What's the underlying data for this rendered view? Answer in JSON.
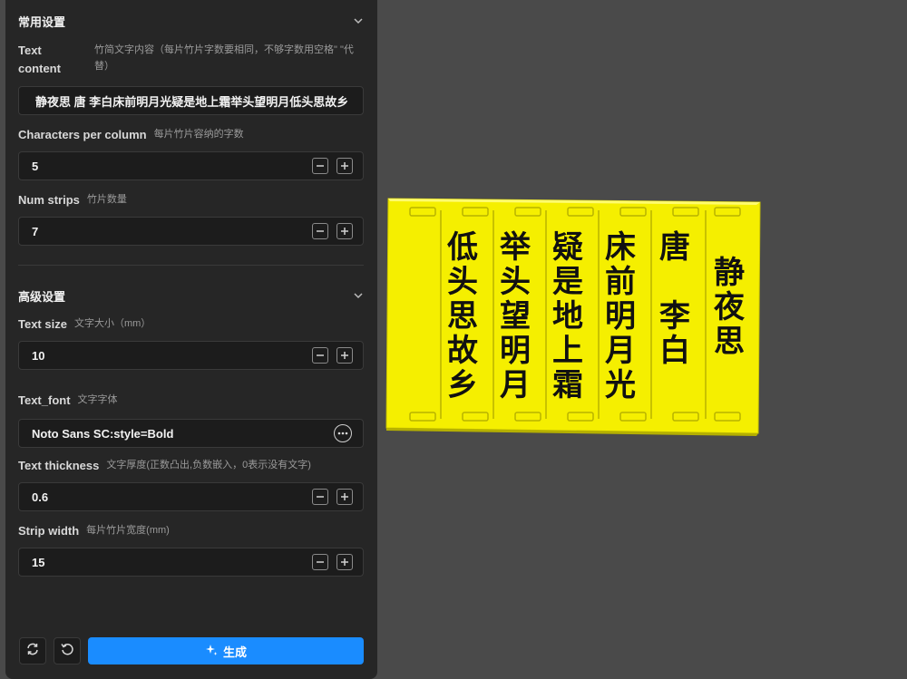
{
  "common": {
    "title": "常用设置",
    "text_content": {
      "label": "Text content",
      "hint": "竹简文字内容（每片竹片字数要相同，不够字数用空格\" \"代替）",
      "value": "静夜思  唐 李白床前明月光疑是地上霜举头望明月低头思故乡"
    },
    "chars_per_column": {
      "label": "Characters per column",
      "hint": "每片竹片容纳的字数",
      "value": "5"
    },
    "num_strips": {
      "label": "Num strips",
      "hint": "竹片数量",
      "value": "7"
    }
  },
  "advanced": {
    "title": "高级设置",
    "text_size": {
      "label": "Text size",
      "hint": "文字大小（mm）",
      "value": "10"
    },
    "text_font": {
      "label": "Text_font",
      "hint": "文字字体",
      "value": "Noto Sans SC:style=Bold"
    },
    "text_thickness": {
      "label": "Text thickness",
      "hint": "文字厚度(正数凸出,负数嵌入，0表示没有文字)",
      "value": "0.6"
    },
    "strip_width": {
      "label": "Strip width",
      "hint": "每片竹片宽度(mm)",
      "value": "15"
    }
  },
  "actions": {
    "generate_label": "生成"
  },
  "model": {
    "strip_color": "#f5ef00",
    "strips": [
      "低头思故乡",
      "举头望明月",
      "疑是地上霜",
      "床前明月光",
      "唐 李白",
      "静夜思"
    ]
  },
  "icons": [
    "chevron-down-icon",
    "minus-icon",
    "plus-icon",
    "more-icon",
    "sync-icon",
    "reset-icon",
    "sparkle-icon"
  ]
}
